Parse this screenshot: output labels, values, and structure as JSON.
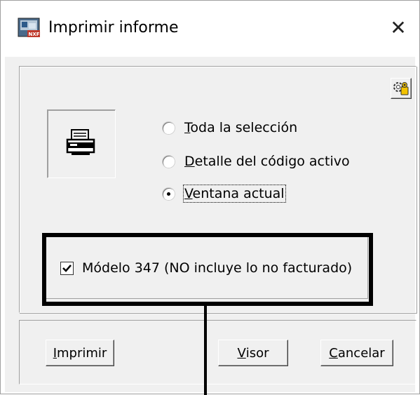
{
  "window": {
    "title": "Imprimir informe",
    "close_glyph": "✕"
  },
  "options": [
    {
      "label_accel": "T",
      "label_rest": "oda la selección",
      "checked": false
    },
    {
      "label_accel": "D",
      "label_rest": "etalle del código activo",
      "checked": false
    },
    {
      "label_accel": "V",
      "label_rest": "entana actual",
      "checked": true
    }
  ],
  "checkbox": {
    "label": "Módelo 347 (NO incluye lo no facturado)",
    "checked": true
  },
  "buttons": {
    "print_accel": "I",
    "print_rest": "mprimir",
    "viewer_accel": "V",
    "viewer_rest": "isor",
    "cancel_accel": "C",
    "cancel_rest": "ancelar"
  },
  "icons": {
    "app": "nxf-app-icon",
    "close": "close-icon",
    "settings": "settings-person-icon",
    "printer": "printer-icon",
    "check": "checkmark-icon"
  }
}
